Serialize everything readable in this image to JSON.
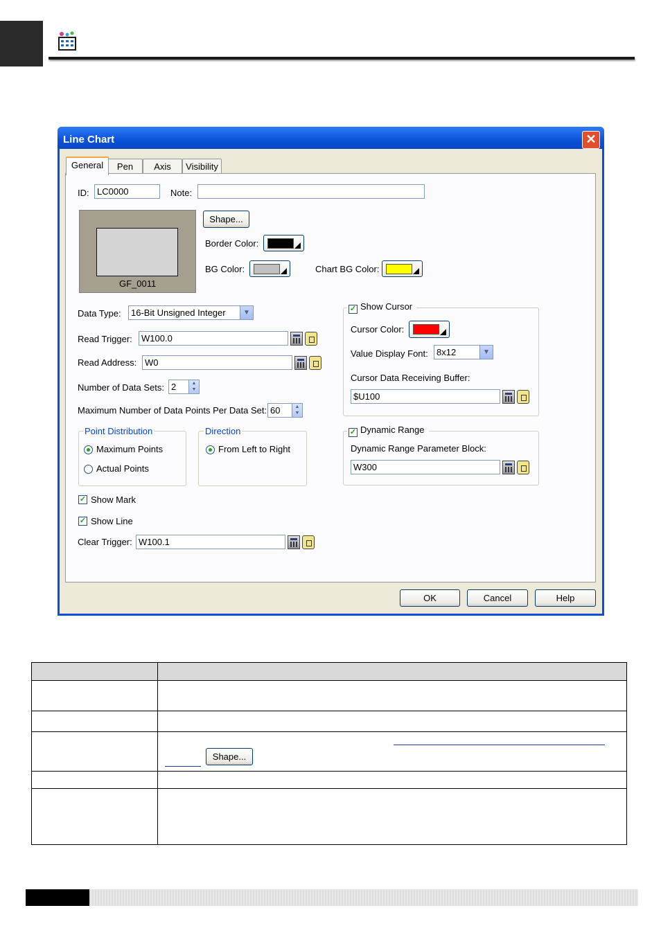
{
  "dialog": {
    "title": "Line Chart",
    "close_glyph": "✕",
    "tabs": [
      "General",
      "Pen",
      "Axis",
      "Visibility"
    ],
    "active_tab": "General",
    "id_label": "ID:",
    "id_value": "LC0000",
    "note_label": "Note:",
    "note_value": "",
    "shape_button": "Shape...",
    "shape_name": "GF_0011",
    "border_color_label": "Border Color:",
    "border_color": "#000000",
    "bg_color_label": "BG Color:",
    "bg_color": "#c0c0c0",
    "chart_bg_color_label": "Chart BG Color:",
    "chart_bg_color": "#ffff00",
    "data_type_label": "Data Type:",
    "data_type_value": "16-Bit Unsigned Integer",
    "read_trigger_label": "Read Trigger:",
    "read_trigger_value": "W100.0",
    "read_address_label": "Read Address:",
    "read_address_value": "W0",
    "num_data_sets_label": "Number of Data Sets:",
    "num_data_sets_value": "2",
    "max_points_label": "Maximum Number of Data Points Per Data Set:",
    "max_points_value": "60",
    "point_distribution": {
      "title": "Point Distribution",
      "options": [
        "Maximum Points",
        "Actual Points"
      ],
      "selected": "Maximum Points"
    },
    "direction": {
      "title": "Direction",
      "options": [
        "From Left to Right"
      ],
      "selected": "From Left to Right"
    },
    "show_mark_label": "Show Mark",
    "show_mark": true,
    "show_line_label": "Show Line",
    "show_line": true,
    "clear_trigger_label": "Clear Trigger:",
    "clear_trigger_value": "W100.1",
    "show_cursor_label": "Show Cursor",
    "show_cursor": true,
    "cursor_color_label": "Cursor Color:",
    "cursor_color": "#ff0000",
    "value_font_label": "Value Display Font:",
    "value_font_value": "8x12",
    "cursor_buffer_label": "Cursor Data Receiving Buffer:",
    "cursor_buffer_value": "$U100",
    "dynamic_range_label": "Dynamic Range",
    "dynamic_range": true,
    "dynamic_block_label": "Dynamic Range Parameter Block:",
    "dynamic_block_value": "W300",
    "buttons": {
      "ok": "OK",
      "cancel": "Cancel",
      "help": "Help"
    }
  },
  "table": {
    "inline_button": "Shape..."
  },
  "icons": [
    "chart-app-icon",
    "close-icon",
    "calculator-icon",
    "tag-icon",
    "chevron-down-icon",
    "spin-arrows-icon"
  ]
}
